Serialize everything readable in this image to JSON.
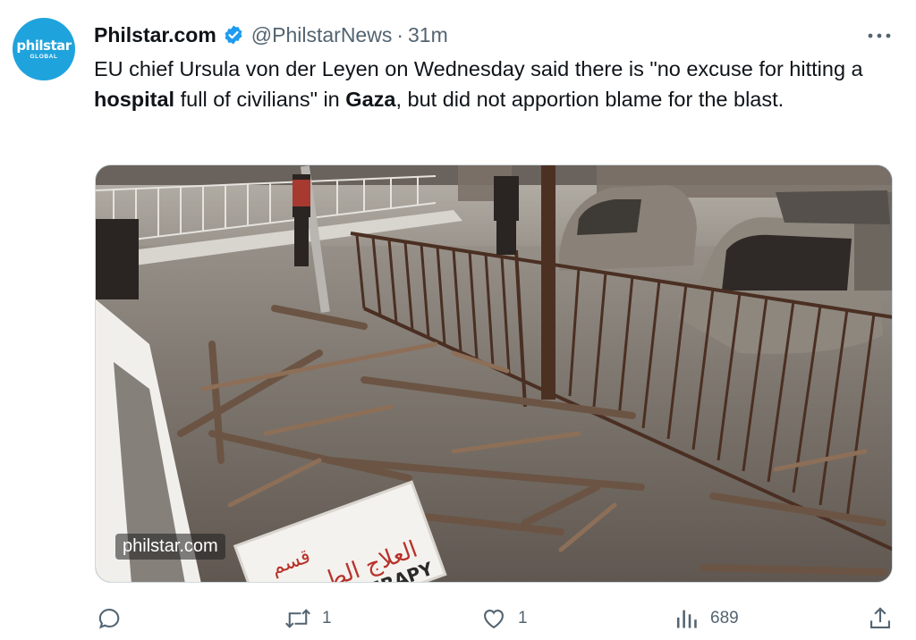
{
  "account": {
    "avatar_brand": "philstar",
    "avatar_sub": "GLOBAL",
    "display_name": "Philstar.com",
    "handle": "@PhilstarNews",
    "separator": "·",
    "time": "31m",
    "verified_icon": "verified-badge-icon",
    "brand_color": "#1fa3dd",
    "verified_color": "#1d9bf0"
  },
  "tweet": {
    "text_part1": "EU chief Ursula von der Leyen on Wednesday said there is \"no excuse for hitting a ",
    "bold1": "hospital",
    "text_part2": " full of civilians\" in ",
    "bold2": "Gaza",
    "text_part3": ", but did not apportion blame for the blast."
  },
  "media": {
    "watermark": "philstar.com",
    "sign_arabic": "العلاج الطبيعي",
    "sign_arabic_top": "قسم",
    "sign_english": "ERAPY"
  },
  "actions": {
    "reply_count": "",
    "retweet_count": "1",
    "like_count": "1",
    "views_count": "689",
    "icons": [
      "reply-icon",
      "retweet-icon",
      "like-icon",
      "views-icon",
      "share-icon"
    ],
    "icon_color": "#536471"
  }
}
